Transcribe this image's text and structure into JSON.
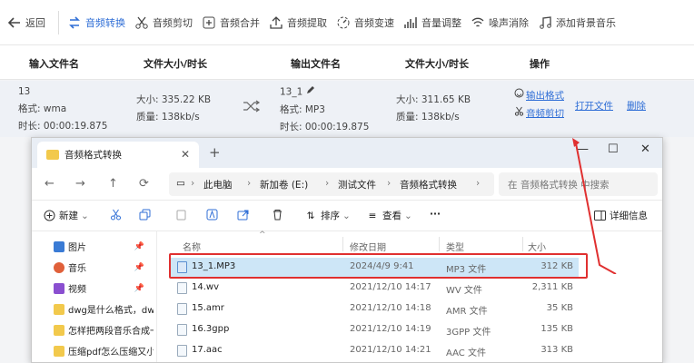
{
  "toolbar": {
    "back": "返回",
    "items": [
      "音频转换",
      "音频剪切",
      "音频合并",
      "音频提取",
      "音频变速",
      "音量调整",
      "噪声消除",
      "添加背景音乐"
    ]
  },
  "table": {
    "headers": [
      "输入文件名",
      "文件大小/时长",
      "输出文件名",
      "文件大小/时长",
      "操作"
    ],
    "row": {
      "in_name": "13",
      "in_format": "格式: wma",
      "in_duration": "时长: 00:00:19.875",
      "in_size": "大小: 335.22 KB",
      "in_quality": "质量: 138kb/s",
      "out_name": "13_1",
      "out_format": "格式: MP3",
      "out_duration": "时长: 00:00:19.875",
      "out_size": "大小: 311.65 KB",
      "out_quality": "质量: 138kb/s",
      "op_output_format": "输出格式",
      "op_cut": "音频剪切",
      "op_open": "打开文件",
      "op_delete": "删除"
    }
  },
  "explorer": {
    "tab_title": "音频格式转换",
    "address": [
      "此电脑",
      "新加卷 (E:)",
      "测试文件",
      "音频格式转换"
    ],
    "search_placeholder": "在 音频格式转换 中搜索",
    "commands": {
      "new": "新建",
      "sort": "排序",
      "view": "查看",
      "details": "详细信息"
    },
    "sidebar": [
      {
        "label": "图片",
        "color": "#3a7bd5",
        "pinned": true
      },
      {
        "label": "音乐",
        "color": "#e0603a",
        "pinned": true
      },
      {
        "label": "视频",
        "color": "#8a4fd0",
        "pinned": true
      },
      {
        "label": "dwg是什么格式，dwg",
        "color": "#f2c94c",
        "pinned": false
      },
      {
        "label": "怎样把两段音乐合成一",
        "color": "#f2c94c",
        "pinned": false
      },
      {
        "label": "压缩pdf怎么压缩又小",
        "color": "#f2c94c",
        "pinned": false
      }
    ],
    "columns": {
      "name": "名称",
      "date": "修改日期",
      "type": "类型",
      "size": "大小"
    },
    "files": [
      {
        "name": "13_1.MP3",
        "date": "2024/4/9 9:41",
        "type": "MP3 文件",
        "size": "312 KB"
      },
      {
        "name": "14.wv",
        "date": "2021/12/10 14:17",
        "type": "WV 文件",
        "size": "2,311 KB"
      },
      {
        "name": "15.amr",
        "date": "2021/12/10 14:18",
        "type": "AMR 文件",
        "size": "35 KB"
      },
      {
        "name": "16.3gpp",
        "date": "2021/12/10 14:19",
        "type": "3GPP 文件",
        "size": "135 KB"
      },
      {
        "name": "17.aac",
        "date": "2021/12/10 14:21",
        "type": "AAC 文件",
        "size": "313 KB"
      }
    ]
  },
  "colors": {
    "accent": "#2f6ed6",
    "highlight": "#e03030",
    "selected_row": "#cde6f7"
  }
}
